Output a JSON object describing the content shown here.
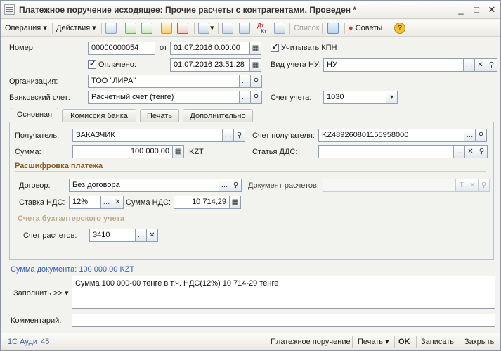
{
  "window": {
    "title": "Платежное поручение исходящее: Прочие расчеты с контрагентами. Проведен *",
    "minimize": "_",
    "maximize": "□",
    "close": "✕"
  },
  "toolbar": {
    "operation": "Операция",
    "actions": "Действия",
    "list": "Список",
    "tips": "Советы",
    "dtkt_top": "Дт",
    "dtkt_bottom": "Кт"
  },
  "form": {
    "number_label": "Номер:",
    "number": "00000000054",
    "from_label": "от",
    "date": "01.07.2016  0:00:00",
    "kpn_label": "Учитывать КПН",
    "paid_label": "Оплачено:",
    "paid_date": "01.07.2016 23:51:28",
    "nu_type_label": "Вид учета НУ:",
    "nu_type": "НУ",
    "org_label": "Организация:",
    "org": "ТОО \"ЛИРА\"",
    "bank_label": "Банковский счет:",
    "bank": "Расчетный счет (тенге)",
    "account_label": "Счет учета:",
    "account": "1030"
  },
  "tabs": [
    {
      "label": "Основная"
    },
    {
      "label": "Комиссия банка"
    },
    {
      "label": "Печать"
    },
    {
      "label": "Дополнительно"
    }
  ],
  "main_tab": {
    "recipient_label": "Получатель:",
    "recipient": "ЗАКАЗЧИК",
    "recipient_account_label": "Счет получателя:",
    "recipient_account": "KZ489260801155958000",
    "sum_label": "Сумма:",
    "sum": "100 000,00",
    "currency": "KZT",
    "dds_label": "Статья ДДС:",
    "dds": "",
    "breakdown_title": "Расшифровка платежа",
    "contract_label": "Договор:",
    "contract": "Без договора",
    "settle_doc_label": "Документ расчетов:",
    "settle_doc": "",
    "vat_rate_label": "Ставка НДС:",
    "vat_rate": "12%",
    "vat_sum_label": "Сумма НДС:",
    "vat_sum": "10 714,29",
    "acc_title": "Счета бухгалтерского учета",
    "settle_acc_label": "Счет расчетов:",
    "settle_acc": "3410"
  },
  "footer": {
    "doc_sum": "Сумма документа: 100 000,00 KZT",
    "fill_label": "Заполнить >>",
    "purpose": "Сумма 100 000-00  тенге в т.ч. НДС(12%) 10 714-29 тенге",
    "comment_label": "Комментарий:",
    "comment": ""
  },
  "bottombar": {
    "audit": "1С Аудит45",
    "payment_order": "Платежное поручение",
    "print": "Печать",
    "ok": "OK",
    "save": "Записать",
    "close": "Закрыть"
  },
  "colors": {
    "accent": "#3a5faa",
    "group_title": "#8a5a1e",
    "input_border": "#8f9eb1"
  }
}
